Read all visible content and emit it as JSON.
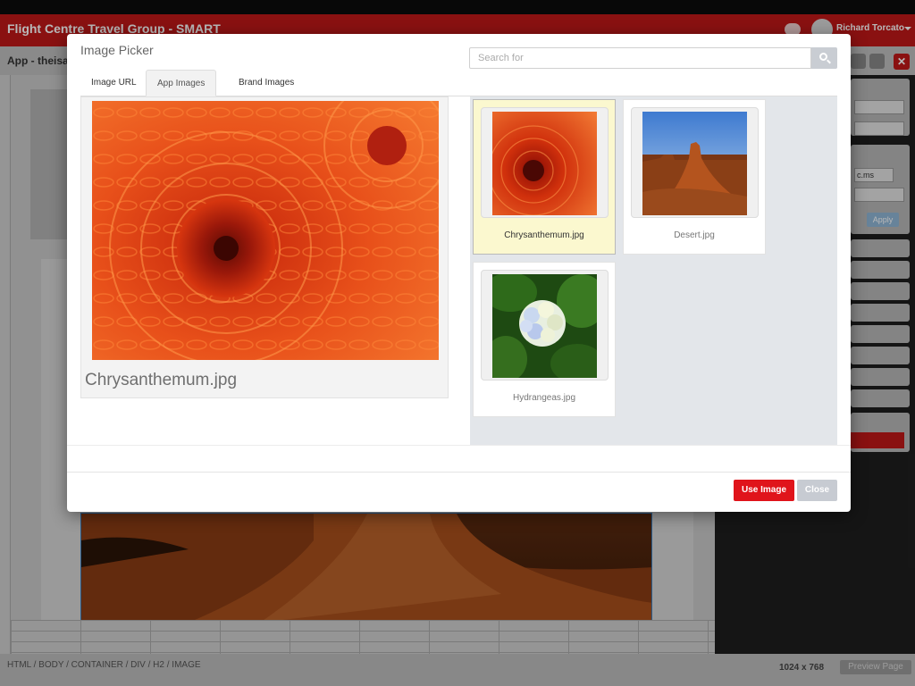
{
  "app": {
    "title": "Flight Centre Travel Group - SMART",
    "user_name": "Richard Torcato",
    "breadcrumb": "App - theisaj"
  },
  "statusbar": {
    "path": "HTML  /  BODY  /  CONTAINER  /  DIV  /  H2  /  IMAGE",
    "dimensions": "1024 x 768",
    "preview_label": "Preview Page"
  },
  "right_panel": {
    "apply_label": "Apply",
    "field_value": "c.ms"
  },
  "modal": {
    "title": "Image Picker",
    "search_placeholder": "Search for",
    "tabs": [
      {
        "label": "Image URL",
        "active": false
      },
      {
        "label": "App Images",
        "active": true
      },
      {
        "label": "Brand Images",
        "active": false
      }
    ],
    "selected_caption": "Chrysanthemum.jpg",
    "images": [
      {
        "label": "Chrysanthemum.jpg",
        "selected": true
      },
      {
        "label": "Desert.jpg",
        "selected": false
      },
      {
        "label": "Hydrangeas.jpg",
        "selected": false
      }
    ],
    "use_button": "Use Image",
    "close_button": "Close"
  },
  "colors": {
    "brand_red": "#c01818",
    "use_button_red": "#e0141b",
    "selected_card": "#fbf8cf",
    "gallery_bg": "#e3e6ea"
  },
  "icons": {
    "search": "search-icon",
    "chat": "chat-icon",
    "close": "close-icon"
  }
}
